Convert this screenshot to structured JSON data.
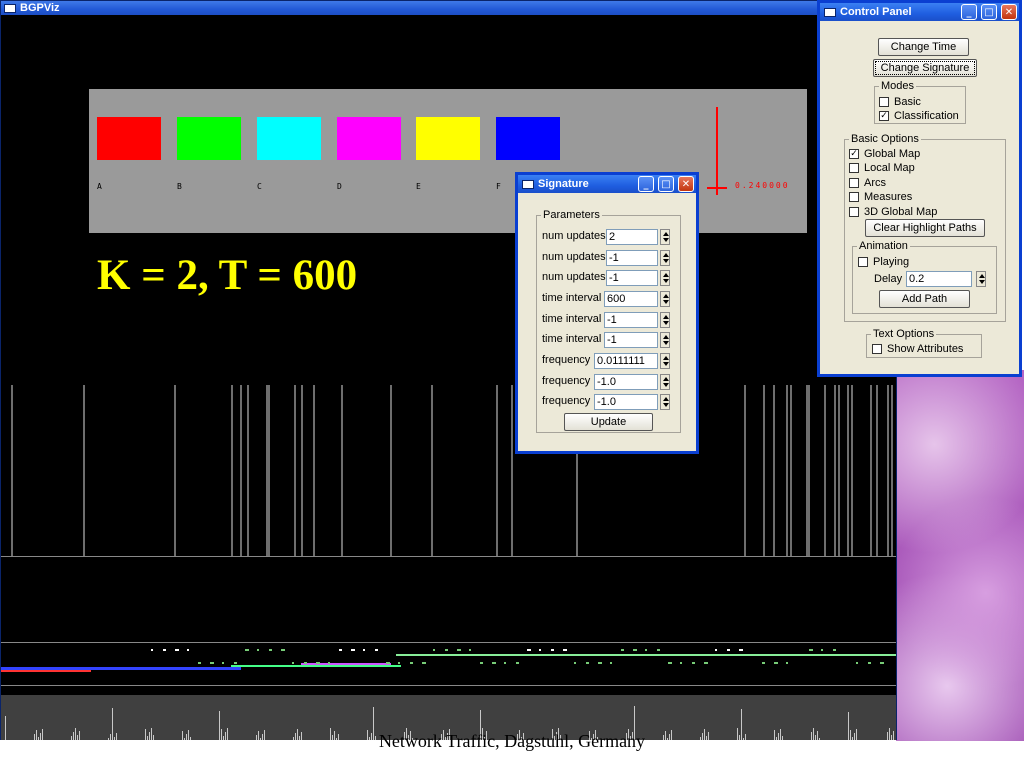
{
  "main_window": {
    "title": "BGPViz"
  },
  "legend": {
    "swatches": [
      {
        "label": "A",
        "color": "#ff0000"
      },
      {
        "label": "B",
        "color": "#00ff00"
      },
      {
        "label": "C",
        "color": "#00ffff"
      },
      {
        "label": "D",
        "color": "#ff00ff"
      },
      {
        "label": "E",
        "color": "#ffff00"
      },
      {
        "label": "F",
        "color": "#0000ff"
      }
    ],
    "scale_value": "0.240000"
  },
  "headline": "K = 2, T = 600",
  "caption": "Network Traffic, Dagstuhl, Germany",
  "signature_window": {
    "title": "Signature",
    "group_title": "Parameters",
    "params": [
      {
        "label": "num updates",
        "value": "2"
      },
      {
        "label": "num updates",
        "value": "-1"
      },
      {
        "label": "num updates",
        "value": "-1"
      },
      {
        "label": "time interval",
        "value": "600"
      },
      {
        "label": "time interval",
        "value": "-1"
      },
      {
        "label": "time interval",
        "value": "-1"
      },
      {
        "label": "frequency",
        "value": "0.0111111"
      },
      {
        "label": "frequency",
        "value": "-1.0"
      },
      {
        "label": "frequency",
        "value": "-1.0"
      }
    ],
    "update_label": "Update"
  },
  "control_panel": {
    "title": "Control Panel",
    "change_time": "Change Time",
    "change_signature": "Change Signature",
    "modes_title": "Modes",
    "modes": [
      {
        "label": "Basic",
        "checked": false
      },
      {
        "label": "Classification",
        "checked": true
      }
    ],
    "basic_options_title": "Basic Options",
    "basic_options": [
      {
        "label": "Global Map",
        "checked": true
      },
      {
        "label": "Local Map",
        "checked": false
      },
      {
        "label": "Arcs",
        "checked": false
      },
      {
        "label": "Measures",
        "checked": false
      },
      {
        "label": "3D Global Map",
        "checked": false
      }
    ],
    "clear_highlight": "Clear Highlight Paths",
    "animation_title": "Animation",
    "playing_label": "Playing",
    "playing_checked": false,
    "delay_label": "Delay",
    "delay_value": "0.2",
    "add_path": "Add Path",
    "text_options_title": "Text Options",
    "show_attributes": "Show Attributes",
    "show_attributes_checked": false
  },
  "viz": {
    "circle_colors": [
      "#ff0000",
      "#00ff00",
      "#00ffff",
      "#ff00ff",
      "#ffff00",
      "#0000ff"
    ]
  }
}
